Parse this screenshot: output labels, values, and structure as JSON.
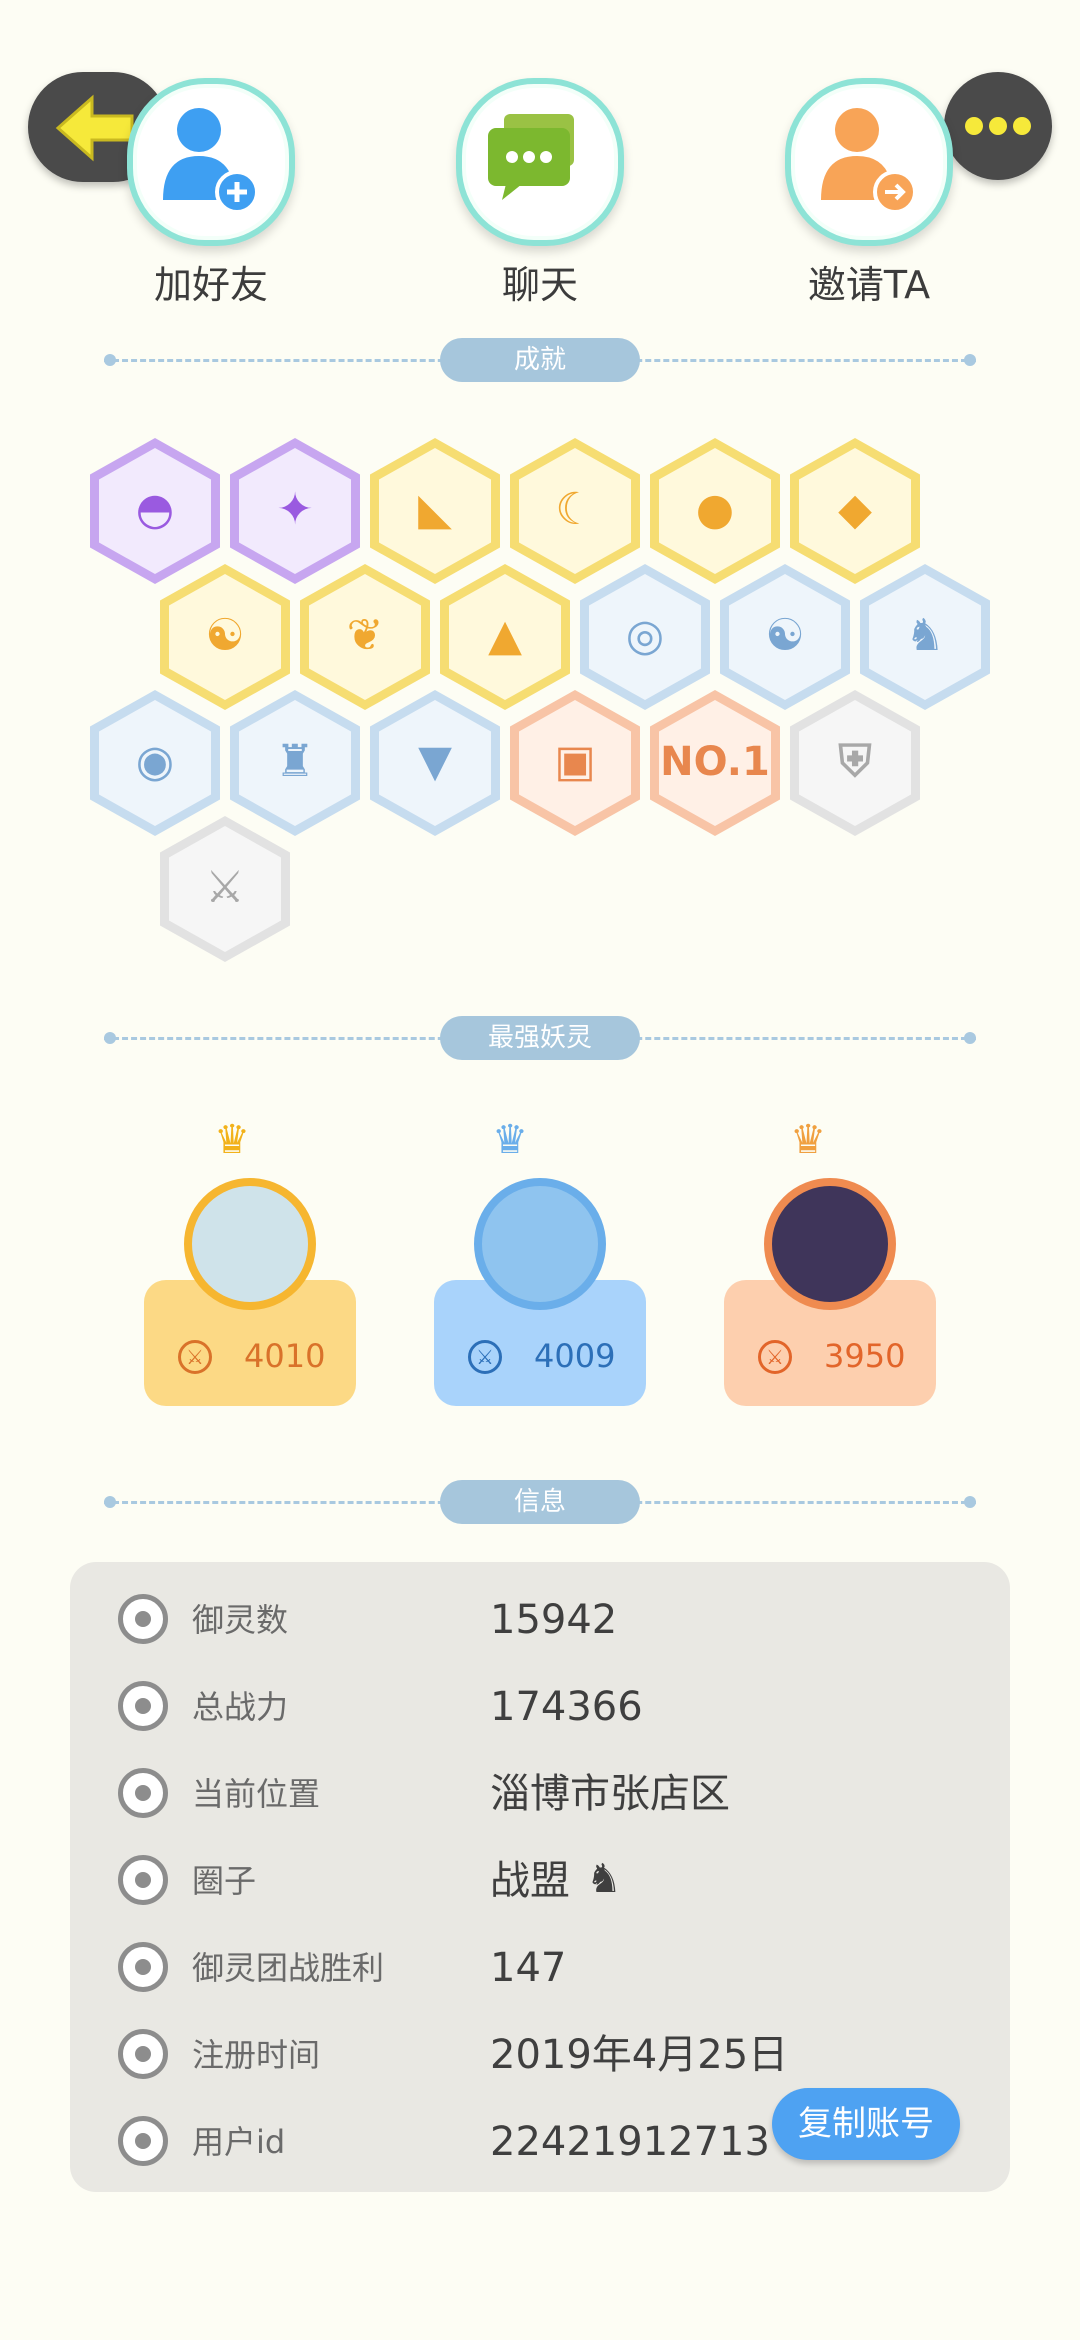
{
  "nav": {
    "back_icon": "arrow-left-icon",
    "more_icon": "more-dots-icon"
  },
  "actions": [
    {
      "label": "加好友",
      "icon": "add-friend-icon"
    },
    {
      "label": "聊天",
      "icon": "chat-icon"
    },
    {
      "label": "邀请TA",
      "icon": "invite-icon"
    }
  ],
  "sections": {
    "achievements": "成就",
    "top_spirits": "最强妖灵",
    "info": "信息"
  },
  "badges": [
    {
      "icon": "purple-devil-badge-icon",
      "color": "#9a5ae0"
    },
    {
      "icon": "purple-cat-badge-icon",
      "color": "#9a5ae0"
    },
    {
      "icon": "shoe-badge-icon",
      "color": "#f0a830"
    },
    {
      "icon": "sun-moon-badge-icon",
      "color": "#f0a830"
    },
    {
      "icon": "orb-badge-icon",
      "color": "#f0a830"
    },
    {
      "icon": "crystal-badge-icon",
      "color": "#f0a830"
    },
    {
      "icon": "yin-yang-box-badge-icon",
      "color": "#f0a830"
    },
    {
      "icon": "fish-badge-icon",
      "color": "#f0a830"
    },
    {
      "icon": "cat-silhouette-badge-icon",
      "color": "#f0a830"
    },
    {
      "icon": "magic-mirror-badge-icon",
      "color": "#7aa6d2"
    },
    {
      "icon": "wave-yin-yang-badge-icon",
      "color": "#7aa6d2"
    },
    {
      "icon": "spirit-figure-badge-icon",
      "color": "#7aa6d2"
    },
    {
      "icon": "banner-shield-badge-icon",
      "color": "#7aa6d2"
    },
    {
      "icon": "monster-badge-icon",
      "color": "#7aa6d2"
    },
    {
      "icon": "book-fox-badge-icon",
      "color": "#7aa6d2"
    },
    {
      "icon": "cart-badge-icon",
      "color": "#e8874e"
    },
    {
      "icon": "no1-badge-icon",
      "color": "#e8874e",
      "text": "NO.1"
    },
    {
      "icon": "winged-shield-badge-icon",
      "color": "#a8a8a8"
    },
    {
      "icon": "crossed-swords-badge-icon",
      "color": "#a8a8a8"
    }
  ],
  "top_spirits": [
    {
      "score": "4010",
      "crown": "gold-crown-icon",
      "avatar": "spirit-avatar-1"
    },
    {
      "score": "4009",
      "crown": "blue-crown-icon",
      "avatar": "spirit-avatar-2"
    },
    {
      "score": "3950",
      "crown": "orange-crown-icon",
      "avatar": "spirit-avatar-3"
    }
  ],
  "info": [
    {
      "label": "御灵数",
      "value": "15942",
      "icon": "spirit-count-icon"
    },
    {
      "label": "总战力",
      "value": "174366",
      "icon": "sword-power-icon"
    },
    {
      "label": "当前位置",
      "value": "淄博市张店区",
      "icon": "location-pin-icon"
    },
    {
      "label": "圈子",
      "value": "战盟",
      "icon": "circle-group-icon",
      "extra_icon": "chess-knight-icon"
    },
    {
      "label": "御灵团战胜利",
      "value": "147",
      "icon": "victory-figure-icon"
    },
    {
      "label": "注册时间",
      "value": "2019年4月25日",
      "icon": "clock-icon"
    },
    {
      "label": "用户id",
      "value": "22421912713",
      "icon": "id-card-icon"
    }
  ],
  "copy_button": "复制账号"
}
